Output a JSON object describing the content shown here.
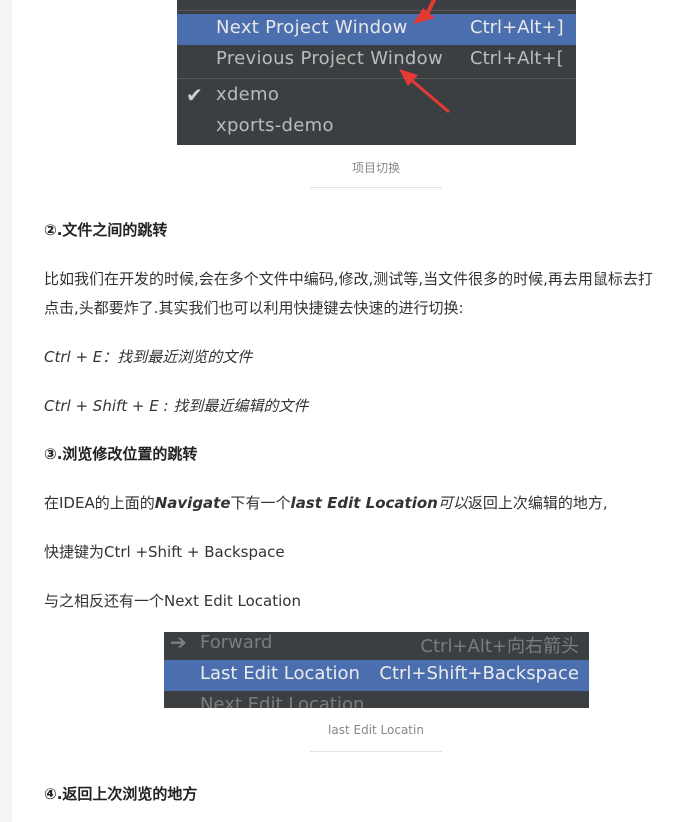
{
  "menu1": {
    "items": [
      {
        "label": "Next Project Window",
        "shortcut": "Ctrl+Alt+]"
      },
      {
        "label": "Previous Project Window",
        "shortcut": "Ctrl+Alt+["
      },
      {
        "label": "xdemo",
        "checked": true
      },
      {
        "label": "xports-demo"
      }
    ],
    "selected_index": 0,
    "arrow_color": "#e53935"
  },
  "caption1": "项目切换",
  "section2": {
    "heading": "②.文件之间的跳转",
    "para_line1": "比如我们在开发的时候,会在多个文件中编码,修改,测试等,当文件很多的时候,再去用鼠标去打",
    "para_line2": "点击,头都要炸了.其实我们也可以利用快捷键去快速的进行切换:",
    "shortcut1": "Ctrl + E：找到最近浏览的文件",
    "shortcut2": "Ctrl + Shift + E : 找到最近编辑的文件"
  },
  "section3": {
    "heading": "③.浏览修改位置的跳转",
    "p1_pre": "在IDEA的上面的",
    "p1_nav": "Navigate",
    "p1_mid": "下有一个",
    "p1_last": "last Edit Location",
    "p1_ky": "可以",
    "p1_post": "返回上次编辑的地方,",
    "p2": "快捷键为Ctrl +Shift + Backspace",
    "p3": "与之相反还有一个Next Edit Location"
  },
  "menu2": {
    "items": [
      {
        "label": "Forward",
        "shortcut": "Ctrl+Alt+向右箭头"
      },
      {
        "label": "Last Edit Location",
        "shortcut": "Ctrl+Shift+Backspace"
      },
      {
        "label": "Next Edit Location",
        "shortcut": ""
      }
    ],
    "selected_index": 1
  },
  "caption2": "last Edit Locatin",
  "section4": {
    "heading": "④.返回上次浏览的地方"
  }
}
